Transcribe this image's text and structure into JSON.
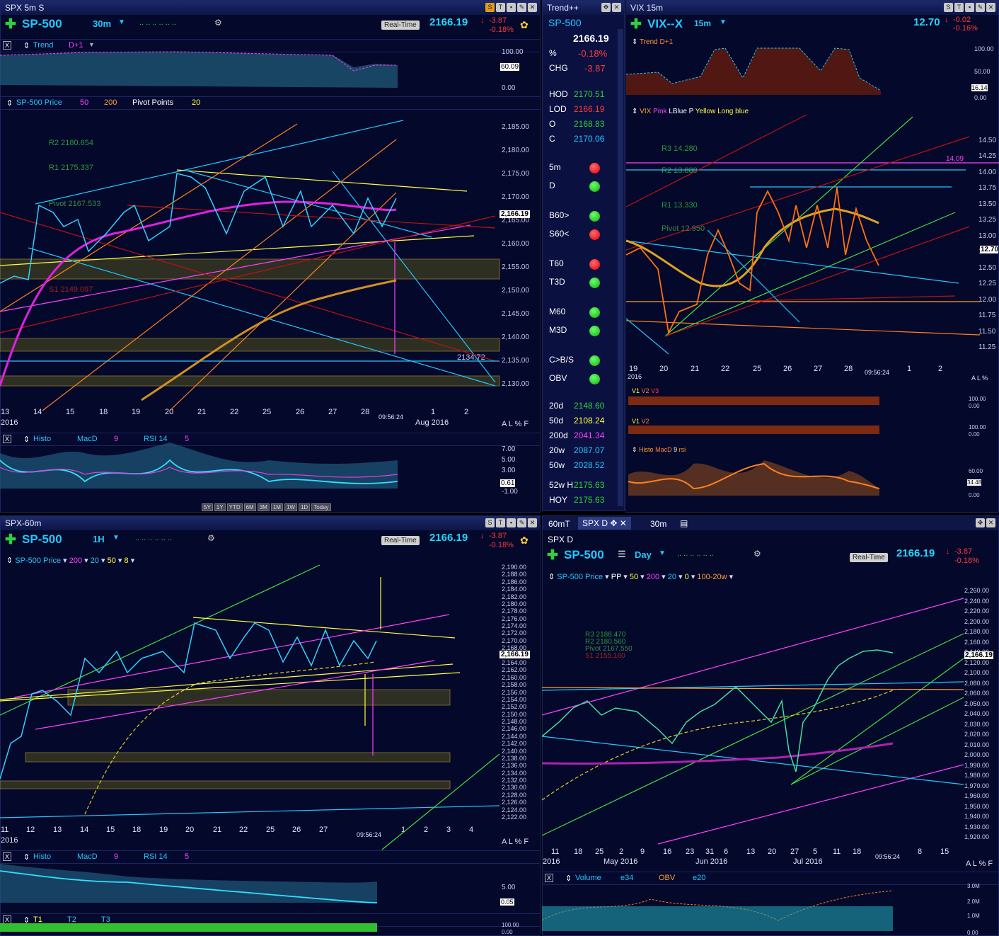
{
  "colors": {
    "accent": "#20c8ff",
    "up": "#2dd23c",
    "down": "#ff3a3a",
    "magenta": "#ff40ff",
    "yellow": "#ffff40",
    "orange": "#ffa030"
  },
  "tl": {
    "title": "SPX 5m S",
    "symbol": "SP-500",
    "tf": "30m",
    "price": "2166.19",
    "chg": "-3.87",
    "pct": "-0.18%",
    "rt": "Real-Time",
    "trend": "Trend",
    "d1": "D+1",
    "trendAxis": [
      "100.00",
      "60.09",
      "0.00"
    ],
    "legend": {
      "name": "SP-500 Price",
      "p1": "50",
      "p2": "200",
      "pp": "Pivot Points",
      "p3": "20"
    },
    "pivots": [
      "R2 2180.654",
      "R1 2175.337",
      "Pivot 2167.533",
      "S1 2149.097"
    ],
    "axis": [
      "2,185.00",
      "2,180.00",
      "2,175.00",
      "2,170.00",
      "2,165.00",
      "2,160.00",
      "2,155.00",
      "2,150.00",
      "2,145.00",
      "2,140.00",
      "2,135.00",
      "2,130.00"
    ],
    "cur": "2,166.19",
    "lbl": "2134.72",
    "dates": [
      "13",
      "14",
      "15",
      "18",
      "19",
      "20",
      "21",
      "22",
      "25",
      "26",
      "27",
      "28",
      "1",
      "2"
    ],
    "year": "2016",
    "month": "Aug 2016",
    "time": "09:56:24",
    "alf": "A  L  %  F",
    "ind": {
      "h": "Histo",
      "m": "MacD",
      "m1": "9",
      "r": "RSI 14",
      "r1": "5"
    },
    "indAxis": [
      "7.00",
      "5.00",
      "3.00",
      "0.61",
      "-1.00"
    ],
    "zoom": [
      "5Y",
      "1Y",
      "YTD",
      "6M",
      "3M",
      "1M",
      "1W",
      "1D",
      "Today"
    ]
  },
  "wl": {
    "title": "Trend++",
    "sym": "SP-500",
    "last": "2166.19",
    "pctK": "%",
    "pct": "-0.18%",
    "chgK": "CHG",
    "chg": "-3.87",
    "rows": [
      {
        "k": "HOD",
        "v": "2170.51",
        "c": "#2dd23c"
      },
      {
        "k": "LOD",
        "v": "2166.19",
        "c": "#ff3a3a"
      },
      {
        "k": "O",
        "v": "2168.83",
        "c": "#2dd23c"
      },
      {
        "k": "C",
        "v": "2170.06",
        "c": "#20c8ff"
      }
    ],
    "sig": [
      {
        "k": "5m",
        "s": "red"
      },
      {
        "k": "D",
        "s": "grn"
      },
      {
        "k": "B60>",
        "s": "grn"
      },
      {
        "k": "S60<",
        "s": "red"
      },
      {
        "k": "T60",
        "s": "red"
      },
      {
        "k": "T3D",
        "s": "grn"
      },
      {
        "k": "M60",
        "s": "grn"
      },
      {
        "k": "M3D",
        "s": "grn"
      },
      {
        "k": "C>B/S",
        "s": "grn"
      },
      {
        "k": "OBV",
        "s": "grn"
      }
    ],
    "ma": [
      {
        "k": "20d",
        "v": "2148.60",
        "c": "#2dd23c"
      },
      {
        "k": "50d",
        "v": "2108.24",
        "c": "#ffff40"
      },
      {
        "k": "200d",
        "v": "2041.34",
        "c": "#ff40ff"
      },
      {
        "k": "20w",
        "v": "2087.07",
        "c": "#20c8ff"
      },
      {
        "k": "50w",
        "v": "2028.52",
        "c": "#20c8ff"
      },
      {
        "k": "52w H",
        "v": "2175.63",
        "c": "#2dd23c"
      },
      {
        "k": "HOY",
        "v": "2175.63",
        "c": "#2dd23c"
      }
    ]
  },
  "tr": {
    "title": "VIX 15m",
    "symbol": "VIX--X",
    "tf": "15m",
    "price": "12.70",
    "chg": "-0.02",
    "pct": "-0.16%",
    "trend": "Trend",
    "d1": "D+1",
    "trendAxis": [
      "100.00",
      "50.00",
      "16.14",
      "0.00"
    ],
    "legend": {
      "name": "VIX",
      "a": "Pink",
      "b": "LBlue",
      "c": "P",
      "d": "Yellow",
      "e": "Long blue"
    },
    "pivots": [
      "R3 14.280",
      "R2 13.880",
      "R1 13.330",
      "Pivot 12.950"
    ],
    "axis": [
      "14.50",
      "14.25",
      "14.00",
      "13.75",
      "13.50",
      "13.25",
      "13.00",
      "12.75",
      "12.50",
      "12.25",
      "12.00",
      "11.75",
      "11.50",
      "11.25"
    ],
    "cur": "12.70",
    "mark": "14.09",
    "dates": [
      "19",
      "20",
      "21",
      "22",
      "25",
      "26",
      "27",
      "28",
      "1",
      "2"
    ],
    "year": "2016",
    "time": "09:56:24",
    "alf": "A  L  %",
    "v1": "V1",
    "v2": "V2",
    "v3": "V3",
    "volAxis": [
      "100.00",
      "0.00"
    ],
    "ind": {
      "h": "Histo",
      "m": "MacD",
      "m1": "9",
      "r": "rsi"
    },
    "indAxis": [
      "60.00",
      "34.48",
      "0.00"
    ]
  },
  "bl": {
    "title": "SPX-60m",
    "symbol": "SP-500",
    "tf": "1H",
    "price": "2166.19",
    "chg": "-3.87",
    "pct": "-0.18%",
    "rt": "Real-Time",
    "legend": {
      "name": "SP-500 Price",
      "p1": "200",
      "p2": "20",
      "p3": "50",
      "p4": "8"
    },
    "axis": [
      "2,190.00",
      "2,188.00",
      "2,186.00",
      "2,184.00",
      "2,182.00",
      "2,180.00",
      "2,178.00",
      "2,176.00",
      "2,174.00",
      "2,172.00",
      "2,170.00",
      "2,168.00",
      "2,166.00",
      "2,164.00",
      "2,162.00",
      "2,160.00",
      "2,158.00",
      "2,156.00",
      "2,154.00",
      "2,152.00",
      "2,150.00",
      "2,148.00",
      "2,146.00",
      "2,144.00",
      "2,142.00",
      "2,140.00",
      "2,138.00",
      "2,136.00",
      "2,134.00",
      "2,132.00",
      "2,130.00",
      "2,128.00",
      "2,126.00",
      "2,124.00",
      "2,122.00"
    ],
    "cur": "2,166.19",
    "dates": [
      "11",
      "12",
      "13",
      "14",
      "15",
      "18",
      "19",
      "20",
      "21",
      "22",
      "25",
      "26",
      "27",
      "1",
      "2",
      "3",
      "4"
    ],
    "year": "2016",
    "time": "09:56:24",
    "alf": "A  L  %  F",
    "ind": {
      "h": "Histo",
      "m": "MacD",
      "m1": "9",
      "r": "RSI 14",
      "r1": "5"
    },
    "indAxis": [
      "5.00",
      "0.05"
    ],
    "t": {
      "t1": "T1",
      "t2": "T2",
      "t3": "T3"
    },
    "tAxis": [
      "100.00",
      "0.00"
    ]
  },
  "br": {
    "tabs": [
      "60mT",
      "SPX D",
      "30m"
    ],
    "title": "SPX D",
    "symbol": "SP-500",
    "tf": "Day",
    "price": "2166.19",
    "chg": "-3.87",
    "pct": "-0.18%",
    "rt": "Real-Time",
    "legend": {
      "name": "SP-500 Price",
      "pp": "PP",
      "p1": "50",
      "p2": "200",
      "p3": "20",
      "p4": "0",
      "p5": "100-20w"
    },
    "pivots": [
      "R3 2188.470",
      "R2 2180.560",
      "Pivot 2167.550",
      "S1 2155.160"
    ],
    "axis": [
      "2,260.00",
      "2,240.00",
      "2,220.00",
      "2,200.00",
      "2,180.00",
      "2,160.00",
      "2,140.00",
      "2,120.00",
      "2,100.00",
      "2,080.00",
      "2,060.00",
      "2,050.00",
      "2,040.00",
      "2,030.00",
      "2,020.00",
      "2,010.00",
      "2,000.00",
      "1,990.00",
      "1,980.00",
      "1,970.00",
      "1,960.00",
      "1,950.00",
      "1,940.00",
      "1,930.00",
      "1,920.00"
    ],
    "cur": "2,166.19",
    "dates": [
      "11",
      "18",
      "25",
      "2",
      "9",
      "16",
      "23",
      "31",
      "6",
      "13",
      "20",
      "27",
      "5",
      "11",
      "18",
      "8",
      "15"
    ],
    "months": [
      "2016",
      "May 2016",
      "Jun 2016",
      "Jul 2016"
    ],
    "time": "09:56:24",
    "alf": "A  L  %  F",
    "vol": {
      "v": "Volume",
      "e": "e34",
      "o": "OBV",
      "e2": "e20"
    },
    "volAxis": [
      "3.0M",
      "2.0M",
      "1.0M",
      "0.00"
    ]
  }
}
